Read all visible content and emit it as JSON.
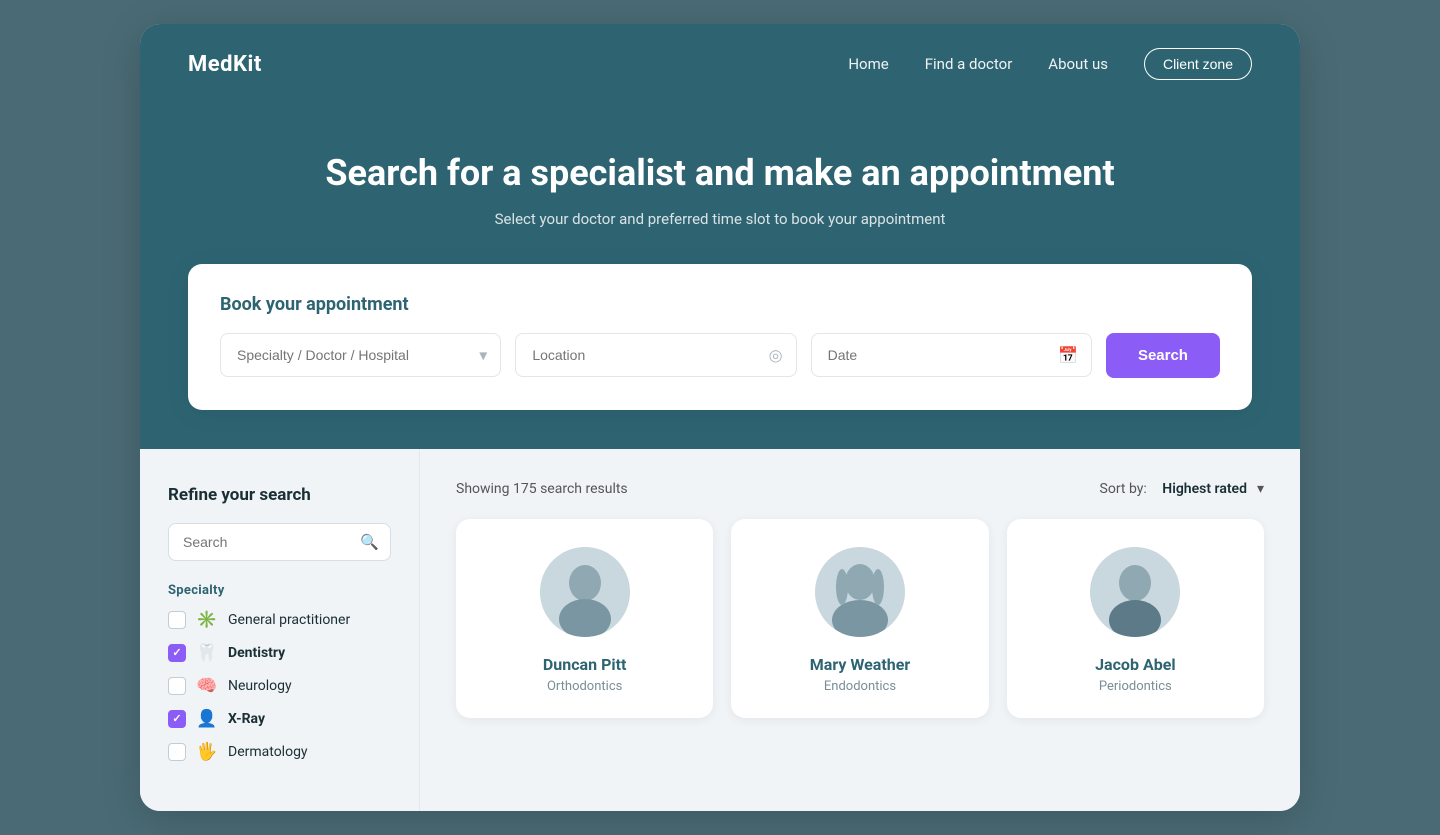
{
  "brand": {
    "logo": "MedKit"
  },
  "nav": {
    "links": [
      "Home",
      "Find a doctor",
      "About us"
    ],
    "cta": "Client zone"
  },
  "hero": {
    "title": "Search for a specialist and make an appointment",
    "subtitle": "Select your doctor and preferred time slot to book your appointment"
  },
  "booking": {
    "card_title": "Book your appointment",
    "specialty_placeholder": "Specialty / Doctor / Hospital",
    "location_placeholder": "Location",
    "date_placeholder": "Date",
    "search_btn": "Search"
  },
  "sidebar": {
    "title": "Refine your search",
    "search_placeholder": "Search",
    "specialty_label": "Specialty",
    "specialties": [
      {
        "name": "General practitioner",
        "checked": false,
        "icon": "✳️",
        "bold": false
      },
      {
        "name": "Dentistry",
        "checked": true,
        "icon": "🦷",
        "bold": true
      },
      {
        "name": "Neurology",
        "checked": false,
        "icon": "🧠",
        "bold": false
      },
      {
        "name": "X-Ray",
        "checked": true,
        "icon": "👤",
        "bold": true
      },
      {
        "name": "Dermatology",
        "checked": false,
        "icon": "🖐",
        "bold": false
      }
    ]
  },
  "results": {
    "count_text": "Showing 175 search results",
    "sort_label": "Sort by:",
    "sort_value": "Highest rated",
    "doctors": [
      {
        "name": "Duncan Pitt",
        "specialty": "Orthodontics",
        "gender": "male"
      },
      {
        "name": "Mary Weather",
        "specialty": "Endodontics",
        "gender": "female"
      },
      {
        "name": "Jacob Abel",
        "specialty": "Periodontics",
        "gender": "male2"
      }
    ]
  }
}
